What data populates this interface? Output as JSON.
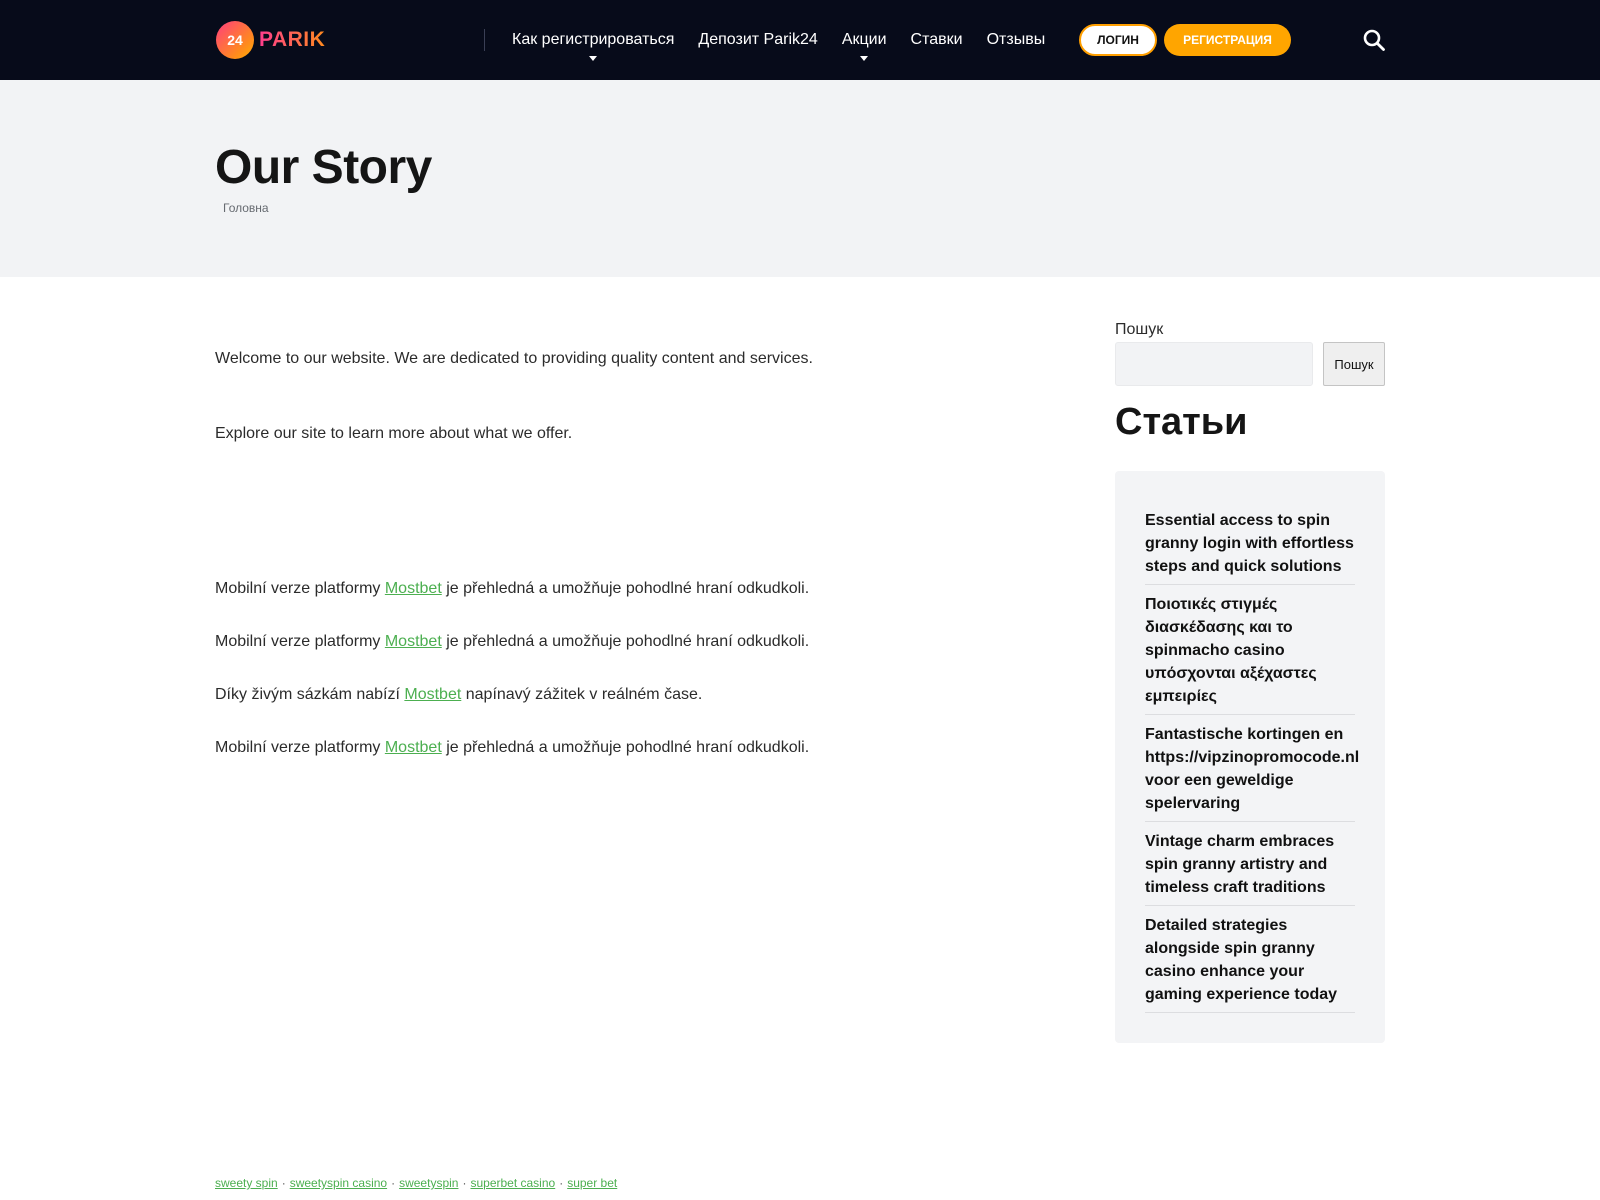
{
  "header": {
    "logo_badge": "24",
    "logo_text": "PARIK",
    "nav": [
      {
        "label": "Как регистрироваться",
        "has_caret": true
      },
      {
        "label": "Депозит Parik24",
        "has_caret": false
      },
      {
        "label": "Акции",
        "has_caret": true
      },
      {
        "label": "Ставки",
        "has_caret": false
      },
      {
        "label": "Отзывы",
        "has_caret": false
      }
    ],
    "login_label": "ЛОГИН",
    "register_label": "РЕГИСТРАЦИЯ",
    "search_icon": "search-icon"
  },
  "hero": {
    "title": "Our Story",
    "breadcrumb": "Головна"
  },
  "content": {
    "intro": "Welcome to our website. We are dedicated to providing quality content and services.",
    "explore": "Explore our site to learn more about what we offer.",
    "paragraphs": [
      {
        "before": "Mobilní verze platformy ",
        "link": "Mostbet",
        "after": " je přehledná a umožňuje pohodlné hraní odkudkoli."
      },
      {
        "before": "Mobilní verze platformy ",
        "link": "Mostbet",
        "after": " je přehledná a umožňuje pohodlné hraní odkudkoli."
      },
      {
        "before": "Díky živým sázkám nabízí ",
        "link": "Mostbet",
        "after": " napínavý zážitek v reálném čase."
      },
      {
        "before": "Mobilní verze platformy ",
        "link": "Mostbet",
        "after": " je přehledná a umožňuje pohodlné hraní odkudkoli."
      }
    ]
  },
  "sidebar": {
    "search_label": "Пошук",
    "search_button": "Пошук",
    "heading": "Статьи",
    "articles": [
      "Essential access to spin granny login with effortless steps and quick solutions",
      "Ποιοτικές στιγμές διασκέδασης και το spinmacho casino υπόσχονται αξέχαστες εμπειρίες",
      "Fantastische kortingen en https://vipzinopromocode.nl voor een geweldige spelervaring",
      "Vintage charm embraces spin granny artistry and timeless craft traditions",
      "Detailed strategies alongside spin granny casino enhance your gaming experience today"
    ]
  },
  "footer": {
    "links": [
      "sweety spin",
      "sweetyspin casino",
      "sweetyspin",
      "superbet casino",
      "super bet"
    ],
    "separator": "·"
  },
  "colors": {
    "header_bg": "#070b1a",
    "accent_orange": "#ffa500",
    "link_green": "#4caf50",
    "hero_bg": "#f2f3f5"
  }
}
